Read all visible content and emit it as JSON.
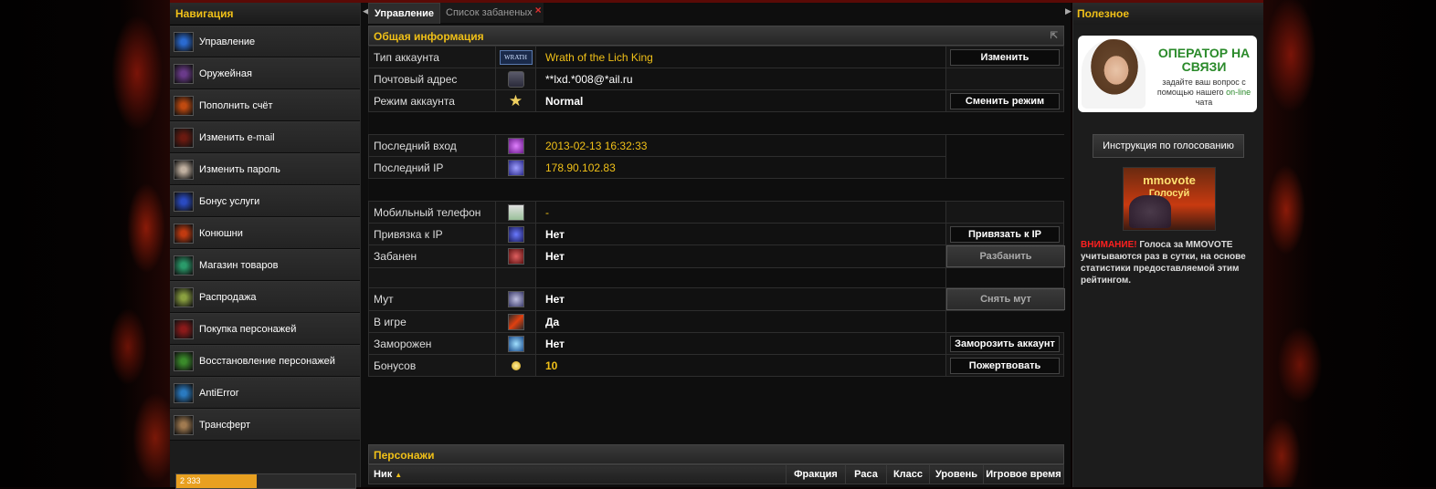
{
  "nav": {
    "title": "Навигация",
    "items": [
      {
        "label": "Управление",
        "icon": "management-icon",
        "color": "#2a6ad0"
      },
      {
        "label": "Оружейная",
        "icon": "armory-icon",
        "color": "#6a3a8a"
      },
      {
        "label": "Пополнить счёт",
        "icon": "deposit-icon",
        "color": "#c04a10"
      },
      {
        "label": "Изменить e-mail",
        "icon": "email-icon",
        "color": "#6a1a10"
      },
      {
        "label": "Изменить пароль",
        "icon": "password-icon",
        "color": "#c0b0a0"
      },
      {
        "label": "Бонус услуги",
        "icon": "bonus-icon",
        "color": "#2a4ac0"
      },
      {
        "label": "Конюшни",
        "icon": "stables-icon",
        "color": "#c03a10"
      },
      {
        "label": "Магазин товаров",
        "icon": "shop-icon",
        "color": "#2a9a6a"
      },
      {
        "label": "Распродажа",
        "icon": "sale-icon",
        "color": "#8aa040"
      },
      {
        "label": "Покупка персонажей",
        "icon": "buy-characters-icon",
        "color": "#8a1a1a"
      },
      {
        "label": "Восстановление персонажей",
        "icon": "restore-characters-icon",
        "color": "#3a8a2a"
      },
      {
        "label": "AntiError",
        "icon": "antierror-icon",
        "color": "#2a7ac0"
      },
      {
        "label": "Трансферт",
        "icon": "transfer-icon",
        "color": "#a07a50"
      }
    ]
  },
  "tabs": [
    {
      "label": "Управление",
      "active": true
    },
    {
      "label": "Список забаненых",
      "active": false
    }
  ],
  "info": {
    "title": "Общая информация",
    "account_type": {
      "label": "Тип аккаунта",
      "value": "Wrath of the Lich King",
      "icon_text": "WRATH",
      "action": "Изменить"
    },
    "email": {
      "label": "Почтовый адрес",
      "value": "**lxd.*008@*ail.ru"
    },
    "mode": {
      "label": "Режим аккаунта",
      "value": "Normal",
      "action": "Сменить режим"
    },
    "last_login": {
      "label": "Последний вход",
      "value": "2013-02-13 16:32:33"
    },
    "last_ip": {
      "label": "Последний IP",
      "value": "178.90.102.83"
    },
    "phone": {
      "label": "Мобильный телефон",
      "value": "-"
    },
    "ip_bind": {
      "label": "Привязка к IP",
      "value": "Нет",
      "action": "Привязать к IP"
    },
    "banned": {
      "label": "Забанен",
      "value": "Нет",
      "action": "Разбанить"
    },
    "mute": {
      "label": "Мут",
      "value": "Нет",
      "action": "Снять мут"
    },
    "in_game": {
      "label": "В игре",
      "value": "Да"
    },
    "frozen": {
      "label": "Заморожен",
      "value": "Нет",
      "action": "Заморозить аккаунт"
    },
    "bonuses": {
      "label": "Бонусов",
      "value": "10",
      "action": "Пожертвовать"
    }
  },
  "characters": {
    "title": "Персонажи",
    "columns": [
      "Ник",
      "Фракция",
      "Раса",
      "Класс",
      "Уровень",
      "Игровое время"
    ]
  },
  "right": {
    "title": "Полезное",
    "banner_title": "ОПЕРАТОР НА СВЯЗИ",
    "banner_text1": "задайте ваш вопрос с помощью нашего",
    "banner_online": "on-line",
    "banner_text2": "чата",
    "vote_button": "Инструкция по голосованию",
    "mmovote_title": "mmovote",
    "mmovote_sub": "Голосуй",
    "warning_label": "ВНИМАНИЕ!",
    "warning_text": "Голоса за MMOVOTE учитываются раз в сутки, на основе статистики предоставляемой этим рейтингом."
  },
  "footer_ad": "2 333"
}
